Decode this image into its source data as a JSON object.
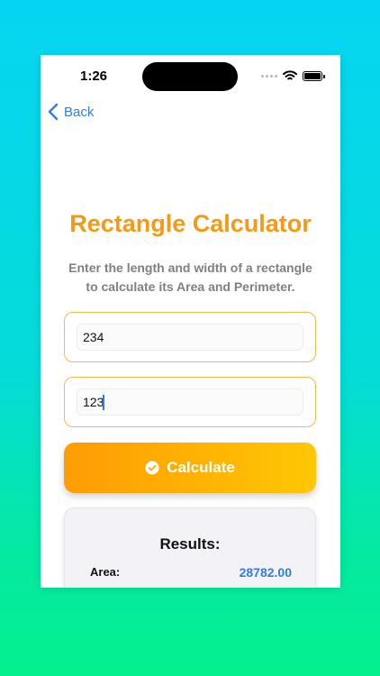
{
  "status_bar": {
    "time": "1:26"
  },
  "nav": {
    "back_label": "Back"
  },
  "header": {
    "title": "Rectangle Calculator",
    "subtitle": "Enter the length and width of a rectangle to calculate its Area and Perimeter."
  },
  "inputs": {
    "length": {
      "value": "234"
    },
    "width": {
      "value": "123"
    }
  },
  "actions": {
    "calculate_label": "Calculate"
  },
  "results": {
    "title": "Results:",
    "rows": [
      {
        "label": "Area:",
        "value": "28782.00"
      }
    ]
  },
  "colors": {
    "accent": "#f49a16",
    "link": "#2f7ee0",
    "button_start": "#fe9c05",
    "button_end": "#ffc705"
  },
  "icons": {
    "back": "chevron-left-icon",
    "calculate": "checkmark-circle-icon",
    "wifi": "wifi-icon",
    "battery": "battery-icon"
  }
}
